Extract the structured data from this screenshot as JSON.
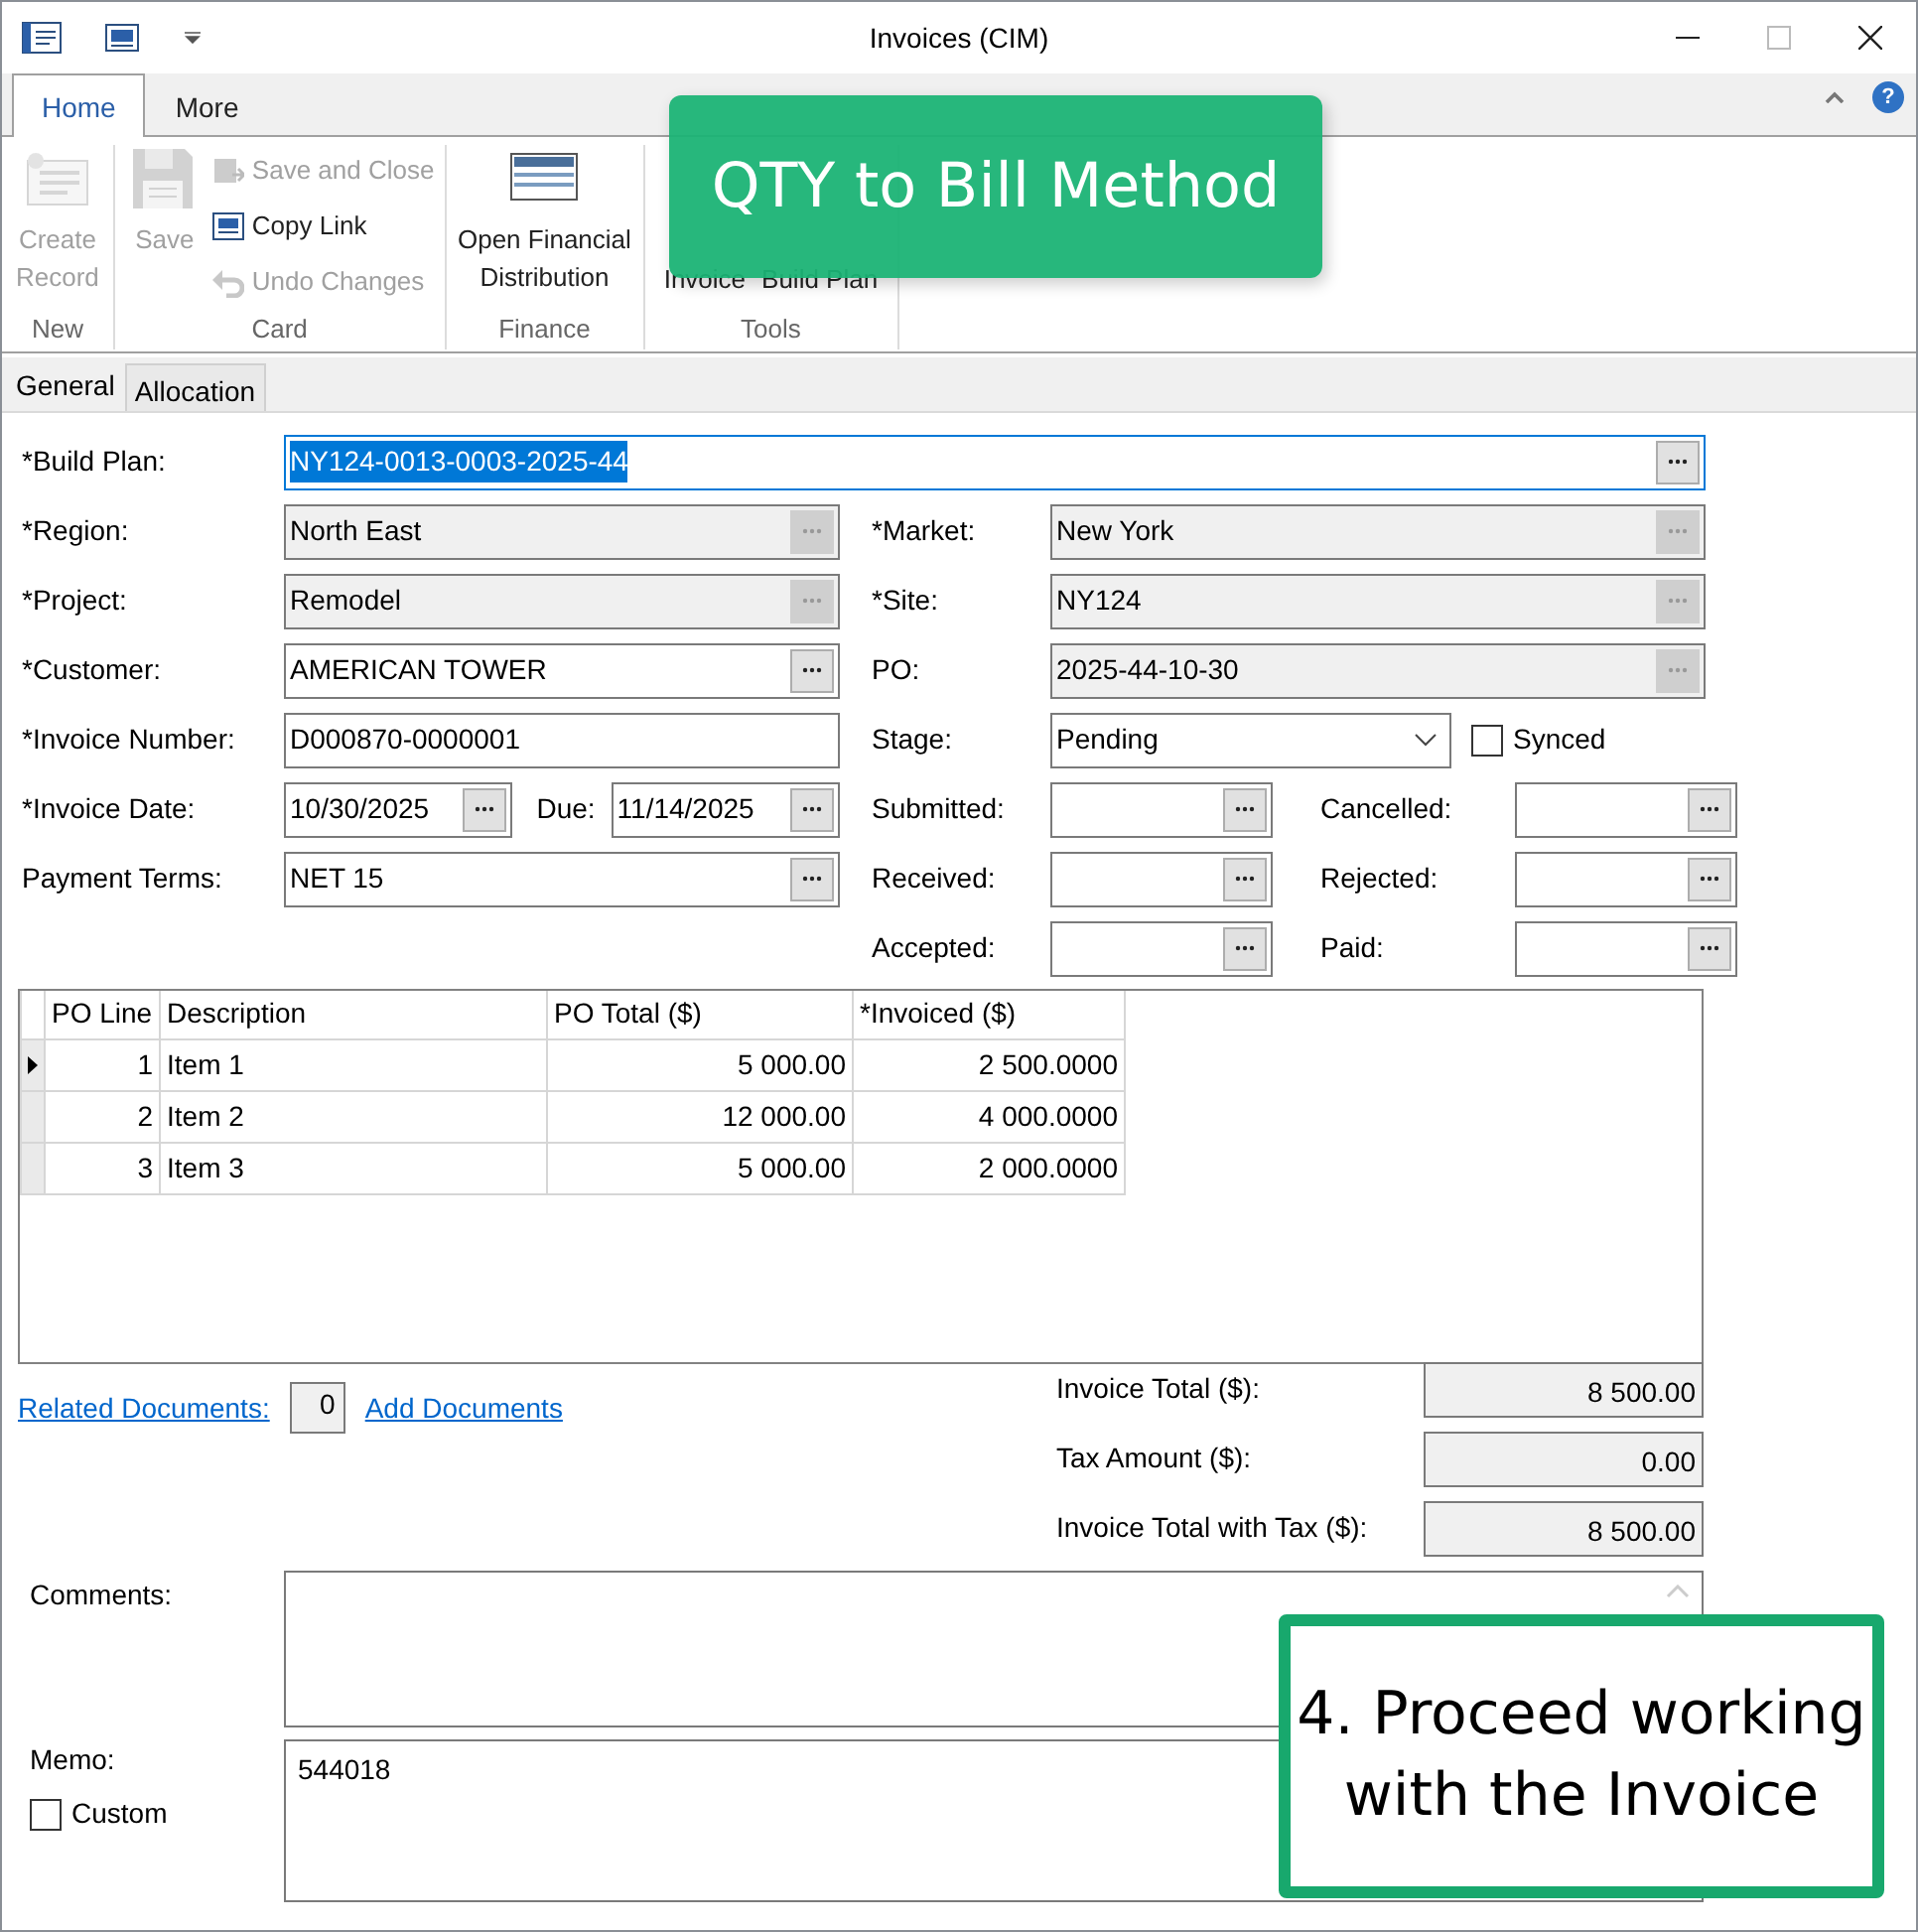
{
  "window": {
    "title": "Invoices (CIM)"
  },
  "ribbon": {
    "tabs": [
      {
        "label": "Home",
        "selected": true
      },
      {
        "label": "More",
        "selected": false
      }
    ],
    "help": "?",
    "groups": [
      {
        "label": "New",
        "items": [
          {
            "label": "Create\nRecord",
            "kind": "large",
            "disabled": true
          }
        ]
      },
      {
        "label": "Card",
        "items": [
          {
            "label": "Save",
            "kind": "large",
            "disabled": true
          },
          {
            "label": "Save and Close",
            "kind": "small",
            "disabled": true
          },
          {
            "label": "Copy Link",
            "kind": "small",
            "disabled": false
          },
          {
            "label": "Undo Changes",
            "kind": "small",
            "disabled": true
          }
        ]
      },
      {
        "label": "Finance",
        "items": [
          {
            "label": "Open Financial\nDistribution",
            "kind": "large",
            "disabled": false
          }
        ]
      },
      {
        "label": "Tools",
        "items": [
          {
            "label": "Invoice",
            "kind": "large",
            "disabled": false
          },
          {
            "label": "Build Plan",
            "kind": "large",
            "disabled": false
          }
        ]
      }
    ]
  },
  "form_tabs": [
    {
      "label": "General",
      "selected": true
    },
    {
      "label": "Allocation",
      "selected": false
    }
  ],
  "rows": [
    {
      "label": "*Build Plan:",
      "left": [
        {
          "kind": "lookup",
          "value": "NY124-0013-0003-2025-44",
          "readonly": false,
          "focused": true
        }
      ]
    },
    {
      "label": "*Region:",
      "left": [
        {
          "kind": "lookup",
          "value": "North East",
          "readonly": true
        }
      ],
      "right_label": "*Market:",
      "right": [
        {
          "kind": "lookup",
          "value": "New York",
          "readonly": true
        }
      ]
    },
    {
      "label": "*Project:",
      "left": [
        {
          "kind": "lookup",
          "value": "Remodel",
          "readonly": true
        }
      ],
      "right_label": "*Site:",
      "right": [
        {
          "kind": "lookup",
          "value": "NY124",
          "readonly": true
        }
      ]
    },
    {
      "label": "*Customer:",
      "left": [
        {
          "kind": "lookup",
          "value": "AMERICAN TOWER",
          "readonly": false
        }
      ],
      "right_label": "PO:",
      "right": [
        {
          "kind": "lookup",
          "value": "2025-44-10-30",
          "readonly": true
        }
      ]
    },
    {
      "label": "*Invoice Number:",
      "left": [
        {
          "kind": "text",
          "value": "D000870-0000001"
        }
      ],
      "right_label": "Stage:",
      "right": [
        {
          "kind": "select",
          "value": "Pending"
        },
        {
          "kind": "checkbox",
          "label": "Synced",
          "checked": false
        }
      ]
    },
    {
      "label": "*Invoice Date:",
      "left": [
        {
          "kind": "date",
          "value": "10/30/2025"
        },
        {
          "kind": "label",
          "text": "Due:"
        },
        {
          "kind": "date",
          "value": "11/14/2025"
        }
      ],
      "right_label": "Submitted:",
      "right": [
        {
          "kind": "date"
        },
        {
          "kind": "label",
          "text": "Cancelled:"
        },
        {
          "kind": "date"
        }
      ]
    },
    {
      "label": "Payment Terms:",
      "left": [
        {
          "kind": "lookup",
          "value": "NET 15",
          "readonly": false
        }
      ],
      "right_label": "Received:",
      "right": [
        {
          "kind": "date"
        },
        {
          "kind": "label",
          "text": "Rejected:"
        },
        {
          "kind": "date"
        }
      ]
    },
    {
      "right_label": "Accepted:",
      "right": [
        {
          "kind": "date"
        },
        {
          "kind": "label",
          "text": "Paid:"
        },
        {
          "kind": "date"
        }
      ]
    }
  ],
  "grid": {
    "columns": [
      "PO Line",
      "Description",
      "PO Total ($)",
      "*Invoiced ($)"
    ],
    "rows": [
      {
        "cells": [
          "1",
          "Item 1",
          "5 000.00",
          "2 500.0000"
        ],
        "current": true
      },
      {
        "cells": [
          "2",
          "Item 2",
          "12 000.00",
          "4 000.0000"
        ],
        "current": false
      },
      {
        "cells": [
          "3",
          "Item 3",
          "5 000.00",
          "2 000.0000"
        ],
        "current": false
      }
    ]
  },
  "related_documents": {
    "link": "Related Documents:",
    "count": "0",
    "add": "Add Documents"
  },
  "totals": [
    {
      "label": "Invoice Total ($):",
      "value": "8 500.00"
    },
    {
      "label": "Tax Amount ($):",
      "value": "0.00"
    },
    {
      "label": "Invoice Total with Tax ($):",
      "value": "8 500.00"
    }
  ],
  "comments": {
    "label": "Comments:"
  },
  "memo": {
    "label": "Memo:",
    "value": "544018",
    "custom": {
      "label": "Custom",
      "checked": false
    }
  },
  "callouts": [
    {
      "text": "QTY to Bill Method",
      "kind": "filled"
    },
    {
      "text": "4. Proceed working\nwith the Invoice",
      "kind": "outlined"
    }
  ]
}
